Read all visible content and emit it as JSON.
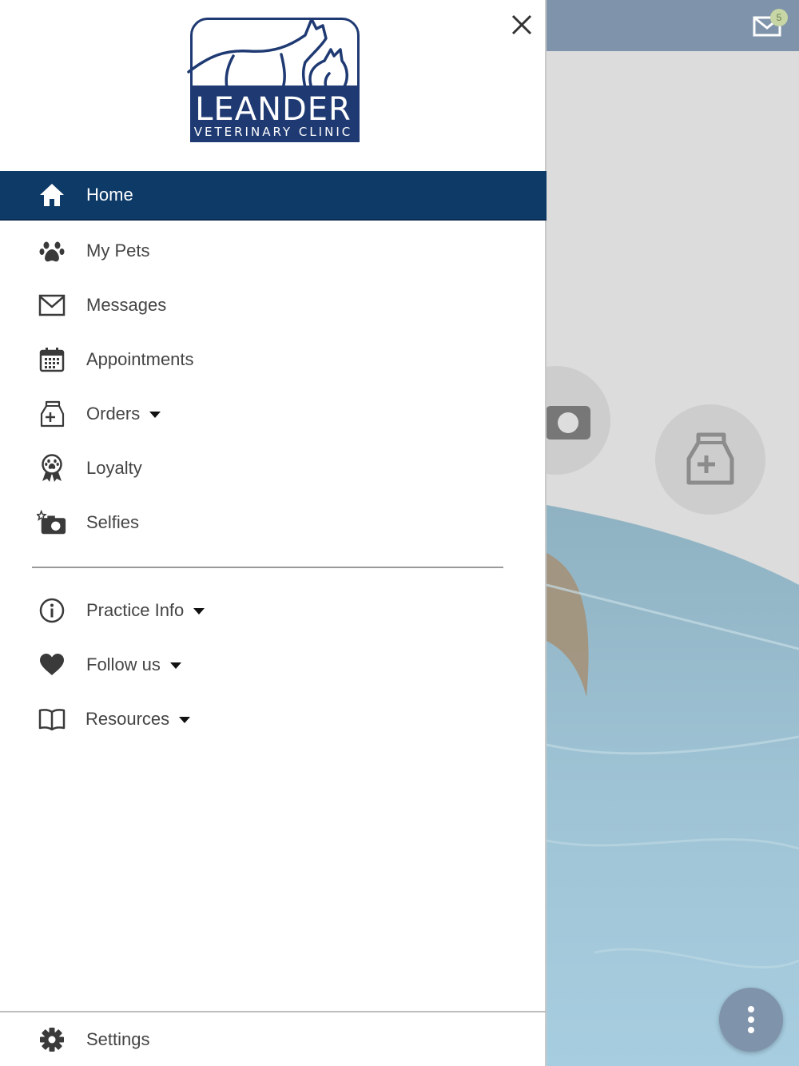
{
  "background": {
    "message_badge_count": "5"
  },
  "logo": {
    "title": "LEANDER",
    "subtitle": "VETERINARY CLINIC"
  },
  "menu": {
    "primary": [
      {
        "label": "Home",
        "icon": "home-icon",
        "active": true
      },
      {
        "label": "My Pets",
        "icon": "paw-icon"
      },
      {
        "label": "Messages",
        "icon": "envelope-icon"
      },
      {
        "label": "Appointments",
        "icon": "calendar-icon"
      },
      {
        "label": "Orders",
        "icon": "medicine-bag-icon",
        "has_dropdown": true
      },
      {
        "label": "Loyalty",
        "icon": "award-ribbon-icon"
      },
      {
        "label": "Selfies",
        "icon": "camera-star-icon"
      }
    ],
    "secondary": [
      {
        "label": "Practice Info",
        "icon": "info-icon",
        "has_dropdown": true
      },
      {
        "label": "Follow us",
        "icon": "heart-icon",
        "has_dropdown": true
      },
      {
        "label": "Resources",
        "icon": "book-icon",
        "has_dropdown": true
      }
    ],
    "footer": {
      "label": "Settings",
      "icon": "gear-icon"
    }
  },
  "colors": {
    "active_bg": "#0d3a67",
    "topbar": "#7f93ab",
    "brand_navy": "#1f3a73"
  }
}
